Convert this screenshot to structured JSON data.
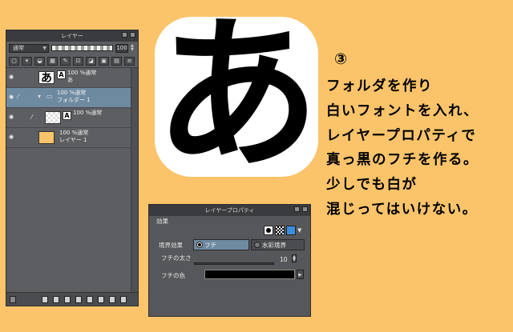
{
  "layer_panel": {
    "title": "レイヤー",
    "blend_mode": "通常",
    "opacity": "100",
    "layers": [
      {
        "info": "100 %通常",
        "name": "あ",
        "badge": "A"
      },
      {
        "info": "100 %通常",
        "name": "フォルダー 1"
      },
      {
        "info": "100 %通常",
        "name": "",
        "badge": "A"
      },
      {
        "info": "100 %通常",
        "name": "レイヤー 1"
      }
    ]
  },
  "big_character": "あ",
  "instructions": {
    "step": "③",
    "lines": [
      "フォルダを作り",
      "白いフォントを入れ、",
      "レイヤープロパティで",
      "真っ黒のフチを作る。",
      "少しでも白が",
      "混じってはいけない。"
    ]
  },
  "property_dialog": {
    "title": "レイヤープロパティ",
    "section": "効果",
    "edge_effect_label": "境界効果",
    "option_edge": "フチ",
    "option_watercolor": "水彩境界",
    "edge_width_label": "フチの太さ",
    "edge_width_value": "10",
    "edge_color_label": "フチの色",
    "edge_color": "#000000"
  },
  "colors": {
    "background": "#fbc46a",
    "panel": "#5c5e61",
    "selection": "#6e8aa1"
  }
}
